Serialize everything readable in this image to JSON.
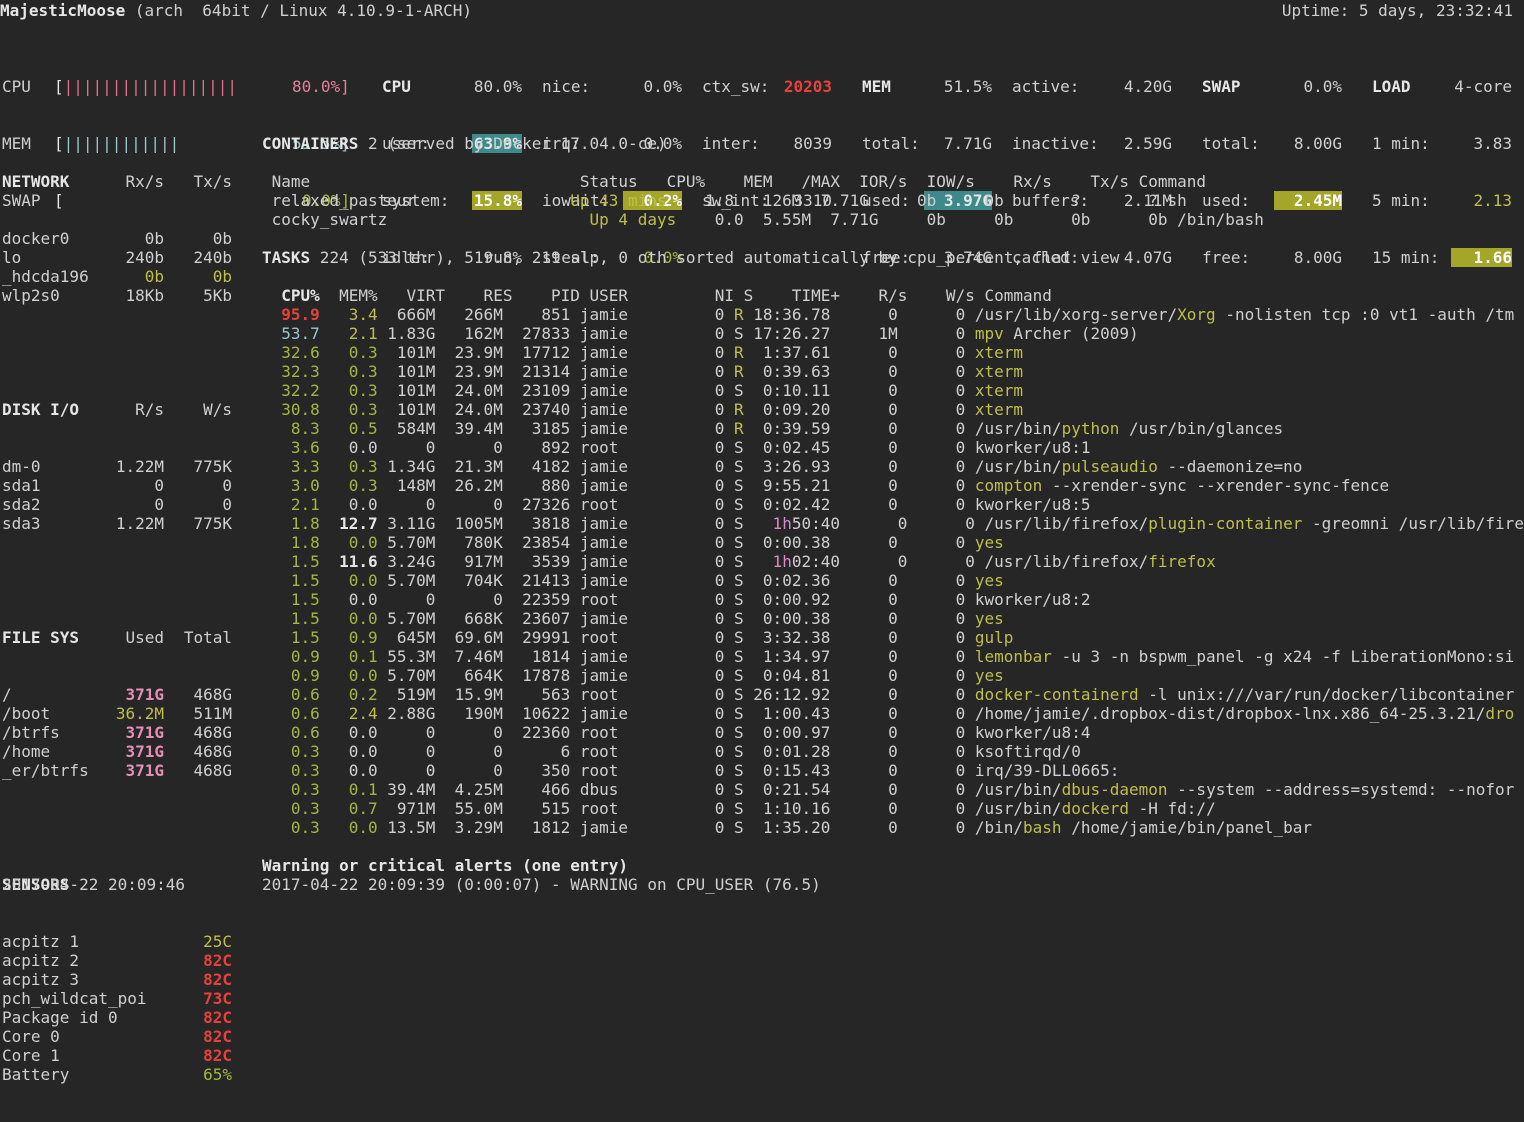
{
  "header": {
    "hostname": "MajesticMoose",
    "sysinfo": " (arch  64bit / Linux 4.10.9-1-ARCH)",
    "uptime": "Uptime: 5 days, 23:32:41"
  },
  "quicklook": {
    "cpu": {
      "label": "CPU",
      "bar": "[||||||||||||||||||",
      "pct": "80.0%]"
    },
    "mem": {
      "label": "MEM",
      "bar": "[||||||||||||",
      "pct": "51.5%]"
    },
    "swap": {
      "label": "SWAP",
      "bar": "[",
      "pct": "0.0%]"
    }
  },
  "cpu": {
    "title": "CPU",
    "total": "80.0%",
    "user_label": "user:",
    "user": "63.9%",
    "system_label": "system:",
    "system": "15.8%",
    "idle_label": "idle:",
    "idle": "19.8%",
    "nice_label": "nice:",
    "nice": "0.0%",
    "irq_label": "irq:",
    "irq": "0.0%",
    "iowait_label": "iowait:",
    "iowait": "0.2%",
    "steal_label": "steal:",
    "steal": "0.0%",
    "ctx_label": "ctx_sw:",
    "ctx": "20203",
    "inter_label": "inter:",
    "inter": "8039",
    "swint_label": "sw_int:",
    "swint": "3310"
  },
  "mem": {
    "title": "MEM",
    "pct": "51.5%",
    "total_label": "total:",
    "total": "7.71G",
    "used_label": "used:",
    "used": "3.97G",
    "free_label": "free:",
    "free": "3.74G",
    "active_label": "active:",
    "active": "4.20G",
    "inactive_label": "inactive:",
    "inactive": "2.59G",
    "buffers_label": "buffers:",
    "buffers": "2.11M",
    "cached_label": "cached:",
    "cached": "4.07G"
  },
  "swap": {
    "title": "SWAP",
    "pct": "0.0%",
    "total_label": "total:",
    "total": "8.00G",
    "used_label": "used:",
    "used": "2.45M",
    "free_label": "free:",
    "free": "8.00G"
  },
  "load": {
    "title": "LOAD",
    "cores": "4-core",
    "m1_label": "1 min:",
    "m1": "3.83",
    "m5_label": "5 min:",
    "m5": "2.13",
    "m15_label": "15 min:",
    "m15": "1.66"
  },
  "network": {
    "title": "NETWORK",
    "rx": "Rx/s",
    "tx": "Tx/s",
    "rows": [
      {
        "name": "docker0",
        "rx": "0b",
        "tx": "0b"
      },
      {
        "name": "lo",
        "rx": "240b",
        "tx": "240b"
      },
      {
        "name": "_hdcda196",
        "rx": "0b",
        "tx": "0b"
      },
      {
        "name": "wlp2s0",
        "rx": "18Kb",
        "tx": "5Kb"
      }
    ]
  },
  "disk": {
    "title": "DISK I/O",
    "r": "R/s",
    "w": "W/s",
    "rows": [
      {
        "name": "dm-0",
        "r": "1.22M",
        "w": "775K"
      },
      {
        "name": "sda1",
        "r": "0",
        "w": "0"
      },
      {
        "name": "sda2",
        "r": "0",
        "w": "0"
      },
      {
        "name": "sda3",
        "r": "1.22M",
        "w": "775K"
      }
    ]
  },
  "fs": {
    "title": "FILE SYS",
    "used": "Used",
    "total": "Total",
    "rows": [
      {
        "name": "/",
        "used": "371G",
        "total": "468G"
      },
      {
        "name": "/boot",
        "used": "36.2M",
        "total": "511M"
      },
      {
        "name": "/btrfs",
        "used": "371G",
        "total": "468G"
      },
      {
        "name": "/home",
        "used": "371G",
        "total": "468G"
      },
      {
        "name": "_er/btrfs",
        "used": "371G",
        "total": "468G"
      }
    ]
  },
  "sensors": {
    "title": "SENSORS",
    "rows": [
      {
        "name": "acpitz 1",
        "val": "25C"
      },
      {
        "name": "acpitz 2",
        "val": "82C"
      },
      {
        "name": "acpitz 3",
        "val": "82C"
      },
      {
        "name": "pch_wildcat_poi",
        "val": "73C"
      },
      {
        "name": "Package id 0",
        "val": "82C"
      },
      {
        "name": "Core 0",
        "val": "82C"
      },
      {
        "name": "Core 1",
        "val": "82C"
      },
      {
        "name": "Battery",
        "val": "65%"
      }
    ]
  },
  "containers": {
    "title": "CONTAINERS",
    "summary": " 2 (served by Docker 17.04.0-ce)",
    "header": " Name                            Status   CPU%    MEM   /MAX  IOR/s  IOW/s    Rx/s    Tx/s Command",
    "rows": [
      {
        "pre": " relaxed_pasteur                ",
        "status": "Up 43 mins",
        "rest": "    1.8   126M  7.71G     0b     0b       ?       ? sh"
      },
      {
        "pre": " cocky_swartz                    ",
        "status": " Up 4 days",
        "rest": "    0.0  5.55M  7.71G     0b     0b      0b      0b /bin/bash"
      }
    ]
  },
  "tasks": {
    "title": "TASKS",
    "summary": " 224 (533 thr), 5 run, 219 slp, 0 oth sorted automatically by cpu_percent, flat view",
    "h_cpu": "  CPU%",
    "h_rest": "  MEM%   VIRT    RES    PID USER         NI S    TIME+    R/s    W/s Command",
    "rows": [
      {
        "cpu": "  95.9",
        "mem": "   3.4",
        "mid": "  666M   266M    851 jamie         0 ",
        "st": "R",
        "t1": "",
        "t2": " 18:36.78",
        "io": "      0      0 ",
        "cp": "/usr/lib/xorg-server/",
        "cn": "Xorg",
        "ca": " -nolisten tcp :0 vt1 -auth /tm"
      },
      {
        "cpu": "  53.7",
        "mem": "   2.1",
        "mid": " 1.83G   162M  27833 jamie         0 ",
        "st": "S",
        "t1": "",
        "t2": " 17:26.27",
        "io": "     1M      0 ",
        "cp": "",
        "cn": "mpv",
        "ca": " Archer (2009)"
      },
      {
        "cpu": "  32.6",
        "mem": "   0.3",
        "mid": "  101M  23.9M  17712 jamie         0 ",
        "st": "R",
        "t1": "",
        "t2": "  1:37.61",
        "io": "      0      0 ",
        "cp": "",
        "cn": "xterm",
        "ca": ""
      },
      {
        "cpu": "  32.3",
        "mem": "   0.3",
        "mid": "  101M  23.9M  21314 jamie         0 ",
        "st": "R",
        "t1": "",
        "t2": "  0:39.63",
        "io": "      0      0 ",
        "cp": "",
        "cn": "xterm",
        "ca": ""
      },
      {
        "cpu": "  32.2",
        "mem": "   0.3",
        "mid": "  101M  24.0M  23109 jamie         0 ",
        "st": "S",
        "t1": "",
        "t2": "  0:10.11",
        "io": "      0      0 ",
        "cp": "",
        "cn": "xterm",
        "ca": ""
      },
      {
        "cpu": "  30.8",
        "mem": "   0.3",
        "mid": "  101M  24.0M  23740 jamie         0 ",
        "st": "R",
        "t1": "",
        "t2": "  0:09.20",
        "io": "      0      0 ",
        "cp": "",
        "cn": "xterm",
        "ca": ""
      },
      {
        "cpu": "   8.3",
        "mem": "   0.5",
        "mid": "  584M  39.4M   3185 jamie         0 ",
        "st": "R",
        "t1": "",
        "t2": "  0:39.59",
        "io": "      0      0 ",
        "cp": "/usr/bin/",
        "cn": "python",
        "ca": " /usr/bin/glances"
      },
      {
        "cpu": "   3.6",
        "mem": "   0.0",
        "mid": "     0      0    892 root          0 ",
        "st": "S",
        "t1": "",
        "t2": "  0:02.45",
        "io": "      0      0 ",
        "cp": "",
        "cn": "",
        "ca": "kworker/u8:1"
      },
      {
        "cpu": "   3.3",
        "mem": "   0.3",
        "mid": " 1.34G  21.3M   4182 jamie         0 ",
        "st": "S",
        "t1": "",
        "t2": "  3:26.93",
        "io": "      0      0 ",
        "cp": "/usr/bin/",
        "cn": "pulseaudio",
        "ca": " --daemonize=no"
      },
      {
        "cpu": "   3.0",
        "mem": "   0.3",
        "mid": "  148M  26.2M    880 jamie         0 ",
        "st": "S",
        "t1": "",
        "t2": "  9:55.21",
        "io": "      0      0 ",
        "cp": "",
        "cn": "compton",
        "ca": " --xrender-sync --xrender-sync-fence"
      },
      {
        "cpu": "   2.1",
        "mem": "   0.0",
        "mid": "     0      0  27326 root          0 ",
        "st": "S",
        "t1": "",
        "t2": "  0:02.42",
        "io": "      0      0 ",
        "cp": "",
        "cn": "",
        "ca": "kworker/u8:5"
      },
      {
        "cpu": "   1.8",
        "mem": "  12.7",
        "mid": " 3.11G  1005M   3818 jamie         0 ",
        "st": "S",
        "t1": "   1h",
        "t2": "50:40",
        "io": "      0      0 ",
        "cp": "/usr/lib/firefox/",
        "cn": "plugin-container",
        "ca": " -greomni /usr/lib/fire"
      },
      {
        "cpu": "   1.8",
        "mem": "   0.0",
        "mid": " 5.70M   780K  23854 jamie         0 ",
        "st": "S",
        "t1": "",
        "t2": "  0:00.38",
        "io": "      0      0 ",
        "cp": "",
        "cn": "yes",
        "ca": ""
      },
      {
        "cpu": "   1.5",
        "mem": "  11.6",
        "mid": " 3.24G   917M   3539 jamie         0 ",
        "st": "S",
        "t1": "   1h",
        "t2": "02:40",
        "io": "      0      0 ",
        "cp": "/usr/lib/firefox/",
        "cn": "firefox",
        "ca": ""
      },
      {
        "cpu": "   1.5",
        "mem": "   0.0",
        "mid": " 5.70M   704K  21413 jamie         0 ",
        "st": "S",
        "t1": "",
        "t2": "  0:02.36",
        "io": "      0      0 ",
        "cp": "",
        "cn": "yes",
        "ca": ""
      },
      {
        "cpu": "   1.5",
        "mem": "   0.0",
        "mid": "     0      0  22359 root          0 ",
        "st": "S",
        "t1": "",
        "t2": "  0:00.92",
        "io": "      0      0 ",
        "cp": "",
        "cn": "",
        "ca": "kworker/u8:2"
      },
      {
        "cpu": "   1.5",
        "mem": "   0.0",
        "mid": " 5.70M   668K  23607 jamie         0 ",
        "st": "S",
        "t1": "",
        "t2": "  0:00.38",
        "io": "      0      0 ",
        "cp": "",
        "cn": "yes",
        "ca": ""
      },
      {
        "cpu": "   1.5",
        "mem": "   0.9",
        "mid": "  645M  69.6M  29991 root          0 ",
        "st": "S",
        "t1": "",
        "t2": "  3:32.38",
        "io": "      0      0 ",
        "cp": "",
        "cn": "gulp",
        "ca": ""
      },
      {
        "cpu": "   0.9",
        "mem": "   0.1",
        "mid": " 55.3M  7.46M   1814 jamie         0 ",
        "st": "S",
        "t1": "",
        "t2": "  1:34.97",
        "io": "      0      0 ",
        "cp": "",
        "cn": "lemonbar",
        "ca": " -u 3 -n bspwm_panel -g x24 -f LiberationMono:si"
      },
      {
        "cpu": "   0.9",
        "mem": "   0.0",
        "mid": " 5.70M   664K  17878 jamie         0 ",
        "st": "S",
        "t1": "",
        "t2": "  0:04.81",
        "io": "      0      0 ",
        "cp": "",
        "cn": "yes",
        "ca": ""
      },
      {
        "cpu": "   0.6",
        "mem": "   0.2",
        "mid": "  519M  15.9M    563 root          0 ",
        "st": "S",
        "t1": "",
        "t2": " 26:12.92",
        "io": "      0      0 ",
        "cp": "",
        "cn": "docker-containerd",
        "ca": " -l unix:///var/run/docker/libcontainer"
      },
      {
        "cpu": "   0.6",
        "mem": "   2.4",
        "mid": " 2.88G   190M  10622 jamie         0 ",
        "st": "S",
        "t1": "",
        "t2": "  1:00.43",
        "io": "      0      0 ",
        "cp": "/home/jamie/.dropbox-dist/dropbox-lnx.x86_64-25.3.21/",
        "cn": "dro",
        "ca": ""
      },
      {
        "cpu": "   0.6",
        "mem": "   0.0",
        "mid": "     0      0  22360 root          0 ",
        "st": "S",
        "t1": "",
        "t2": "  0:00.97",
        "io": "      0      0 ",
        "cp": "",
        "cn": "",
        "ca": "kworker/u8:4"
      },
      {
        "cpu": "   0.3",
        "mem": "   0.0",
        "mid": "     0      0      6 root          0 ",
        "st": "S",
        "t1": "",
        "t2": "  0:01.28",
        "io": "      0      0 ",
        "cp": "",
        "cn": "",
        "ca": "ksoftirqd/0"
      },
      {
        "cpu": "   0.3",
        "mem": "   0.0",
        "mid": "     0      0    350 root          0 ",
        "st": "S",
        "t1": "",
        "t2": "  0:15.43",
        "io": "      0      0 ",
        "cp": "",
        "cn": "",
        "ca": "irq/39-DLL0665:"
      },
      {
        "cpu": "   0.3",
        "mem": "   0.1",
        "mid": " 39.4M  4.25M    466 dbus          0 ",
        "st": "S",
        "t1": "",
        "t2": "  0:21.54",
        "io": "      0      0 ",
        "cp": "/usr/bin/",
        "cn": "dbus-daemon",
        "ca": " --system --address=systemd: --nofor"
      },
      {
        "cpu": "   0.3",
        "mem": "   0.7",
        "mid": "  971M  55.0M    515 root          0 ",
        "st": "S",
        "t1": "",
        "t2": "  1:10.16",
        "io": "      0      0 ",
        "cp": "/usr/bin/",
        "cn": "dockerd",
        "ca": " -H fd://"
      },
      {
        "cpu": "   0.3",
        "mem": "   0.0",
        "mid": " 13.5M  3.29M   1812 jamie         0 ",
        "st": "S",
        "t1": "",
        "t2": "  1:35.20",
        "io": "      0      0 ",
        "cp": "/bin/",
        "cn": "bash",
        "ca": " /home/jamie/bin/panel_bar"
      }
    ]
  },
  "alerts": {
    "title": "Warning or critical alerts (one entry)",
    "entry": "2017-04-22 20:09:39 (0:00:07) - WARNING on CPU_USER (76.5)"
  },
  "footer": {
    "datetime": "2017-04-22 20:09:46"
  },
  "colors": {
    "background": "#262626",
    "critical": "#e6413a",
    "warning": "#bfbf4a",
    "ok": "#a2b83e",
    "highlight_careful": "#3e8a8a",
    "highlight_warning": "#a4a62a"
  }
}
